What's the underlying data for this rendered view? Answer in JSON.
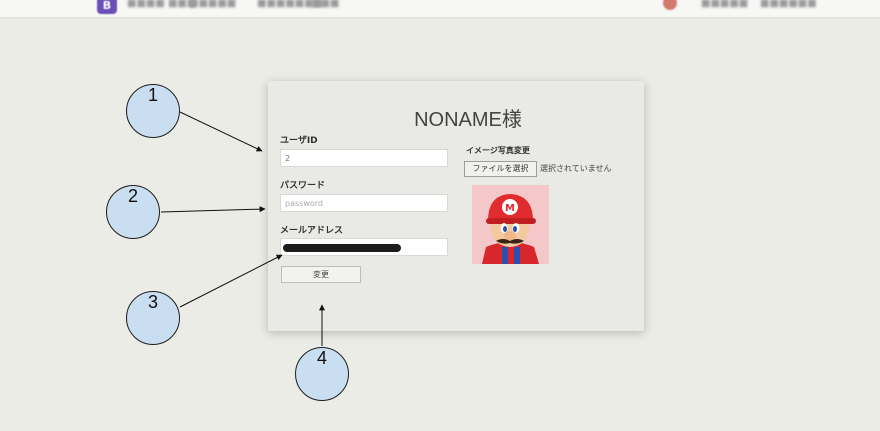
{
  "nav": {
    "brand": "B",
    "links": [
      "■■■■ ■■■",
      "■■■■■",
      "■■■■■■■",
      "■■■"
    ],
    "right_links": [
      "■■■■■",
      "■■■■■■"
    ]
  },
  "card": {
    "title": "NONAME様",
    "user_id_label": "ユーザID",
    "user_id_value": "2",
    "password_label": "パスワード",
    "password_placeholder": "password",
    "email_label": "メールアドレス",
    "submit_label": "変更",
    "image_label": "イメージ写真変更",
    "file_button_label": "ファイルを選択",
    "file_status": "選択されていません",
    "avatar_emblem": "M"
  },
  "annotations": [
    "1",
    "2",
    "3",
    "4"
  ]
}
